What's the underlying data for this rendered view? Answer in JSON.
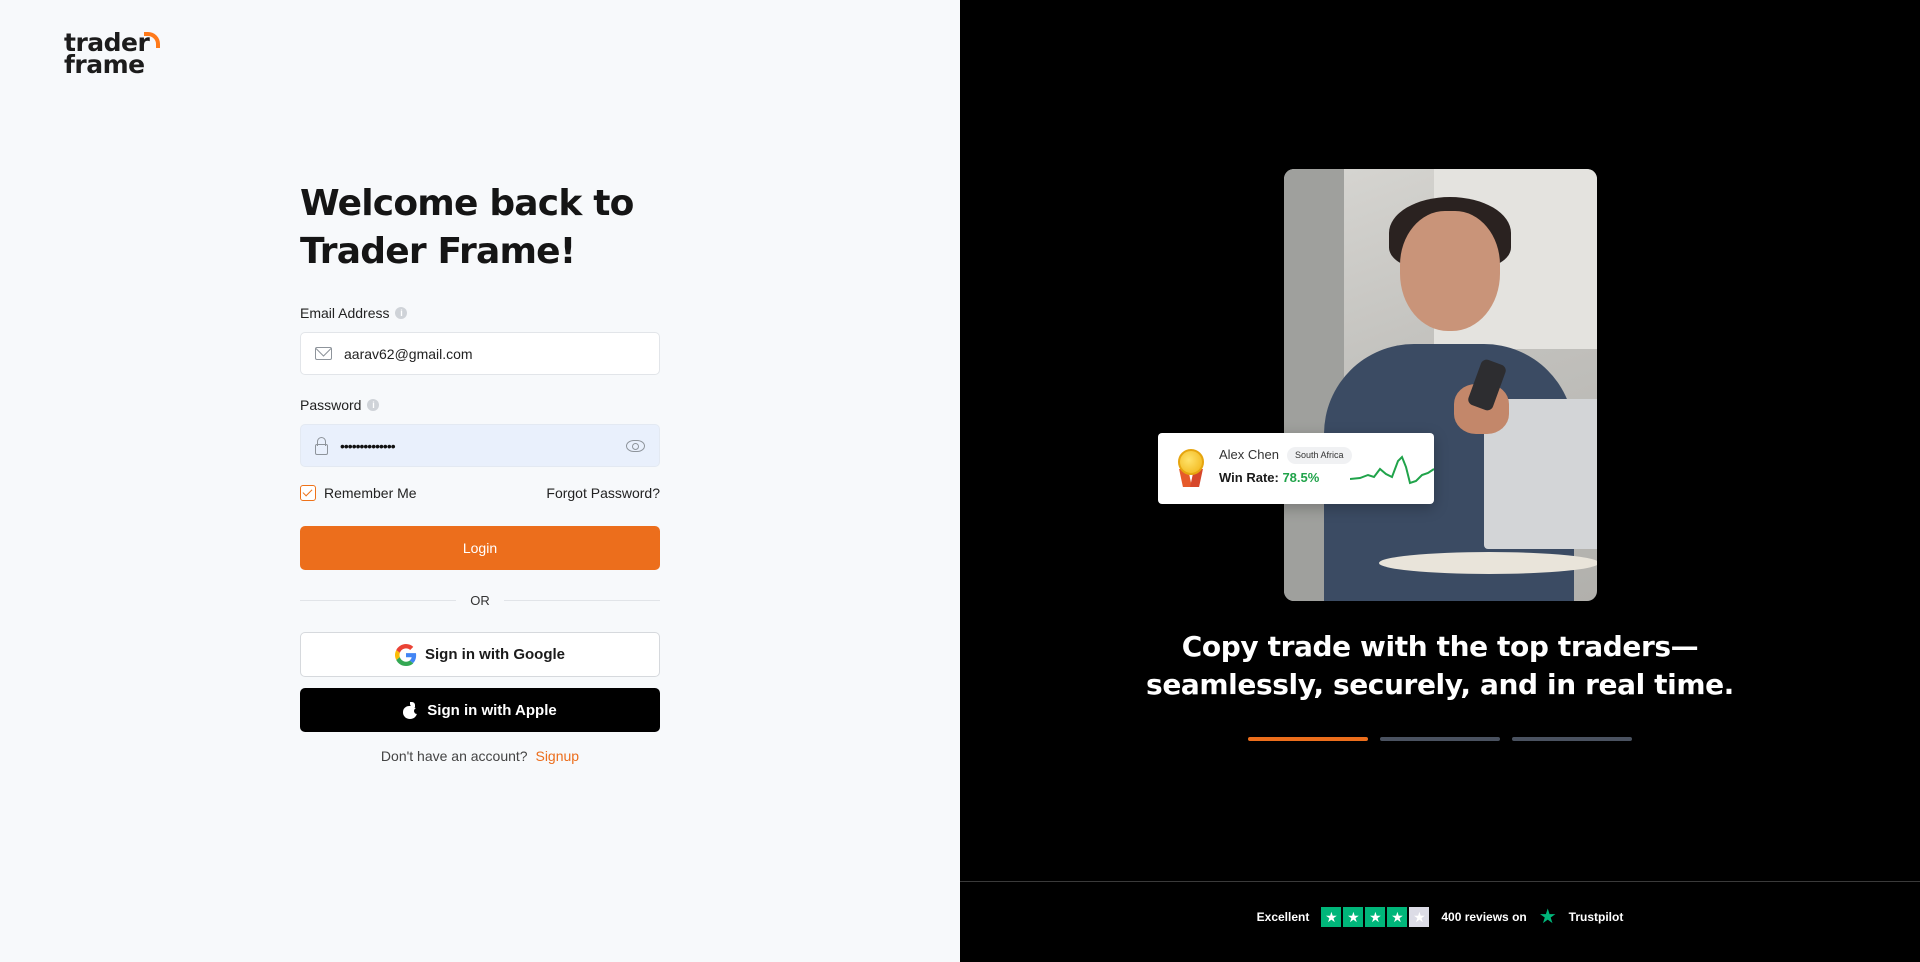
{
  "brand": {
    "logo_line1": "trader",
    "logo_line2": "frame",
    "accent": "#ec6e1c"
  },
  "login": {
    "title_line1": "Welcome back to",
    "title_line2": "Trader Frame!",
    "email_label": "Email Address",
    "email_value": "aarav62@gmail.com",
    "password_label": "Password",
    "password_masked": "••••••••••••••",
    "remember_label": "Remember Me",
    "remember_checked": true,
    "forgot_label": "Forgot Password?",
    "login_label": "Login",
    "or_label": "OR",
    "google_label": "Sign in with Google",
    "apple_label": "Sign in with Apple",
    "signup_prompt": "Don't have an account?",
    "signup_label": "Signup"
  },
  "promo": {
    "trader_name": "Alex Chen",
    "trader_country": "South Africa",
    "win_rate_label": "Win Rate:",
    "win_rate_value": "78.5%",
    "headline_line1": "Copy trade with the top traders—",
    "headline_line2": "seamlessly, securely, and in real time.",
    "carousel": {
      "count": 3,
      "active_index": 0
    }
  },
  "trustpilot": {
    "rating_label": "Excellent",
    "stars_full": 4,
    "stars_total": 5,
    "reviews_text": "400 reviews on",
    "brand": "Trustpilot",
    "color": "#00b67a"
  }
}
